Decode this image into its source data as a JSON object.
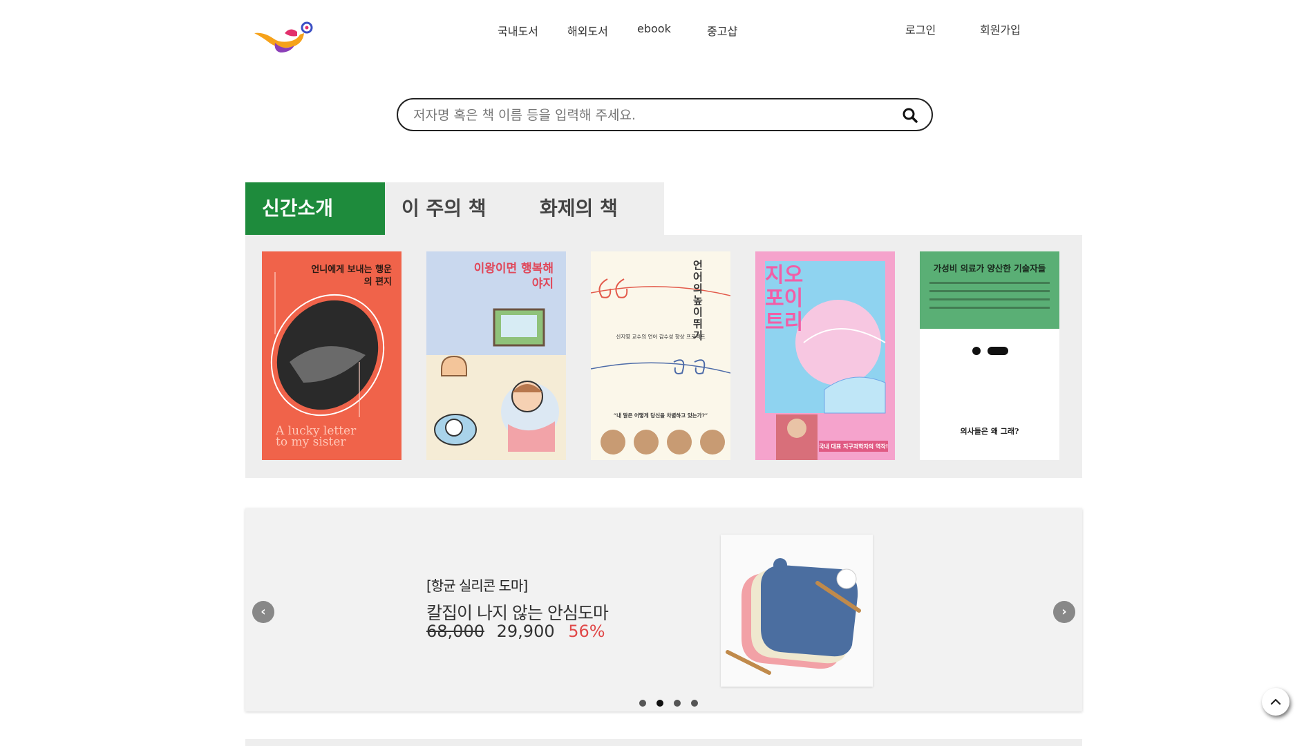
{
  "header": {
    "logo_icon": "magic-lamp-logo-icon",
    "nav": [
      {
        "label": "국내도서"
      },
      {
        "label": "해외도서"
      },
      {
        "label": "ebook"
      },
      {
        "label": "중고샵"
      }
    ],
    "auth": {
      "login": "로그인",
      "signup": "회원가입"
    }
  },
  "search": {
    "placeholder": "저자명 혹은 책 이름 등을 입력해 주세요.",
    "value": "",
    "icon": "search-icon"
  },
  "tabs": [
    {
      "label": "신간소개",
      "active": true
    },
    {
      "label": "이 주의 책",
      "active": false
    },
    {
      "label": "화제의 책",
      "active": false
    }
  ],
  "books": [
    {
      "title": "언니에게 보내는 행운의 편지",
      "subtitle": "A lucky letter to my sister",
      "cover_color": "#f0634a"
    },
    {
      "title": "이왕이면 행복해야지",
      "cover_color": "#c9d8ee"
    },
    {
      "title": "언어의 높이뛰기",
      "subtitle": "신지영 교수의 언어 감수성 향상 프로젝트",
      "quote": "“내 말은 어떻게 당신을 차별하고 있는가?”",
      "cover_color": "#fbf7ea"
    },
    {
      "title": "지오 포이트리",
      "subtitle": "국내 대표 지구과학자의 역작!",
      "cover_color": "#f5a3cc"
    },
    {
      "title": "가성비 의료가 양산한 기술자들",
      "bottom": "의사들은 왜 그래?",
      "cover_color": "#5aaf75"
    }
  ],
  "banner": {
    "tag": "[항균 실리콘 도마]",
    "title": "칼집이 나지 않는 안심도마",
    "original_price": "68,000",
    "sale_price": "29,900",
    "discount": "56%",
    "slide_count": 4,
    "active_slide": 1,
    "prev_icon": "chevron-left-icon",
    "next_icon": "chevron-right-icon"
  },
  "scroll_top_icon": "chevron-up-icon"
}
